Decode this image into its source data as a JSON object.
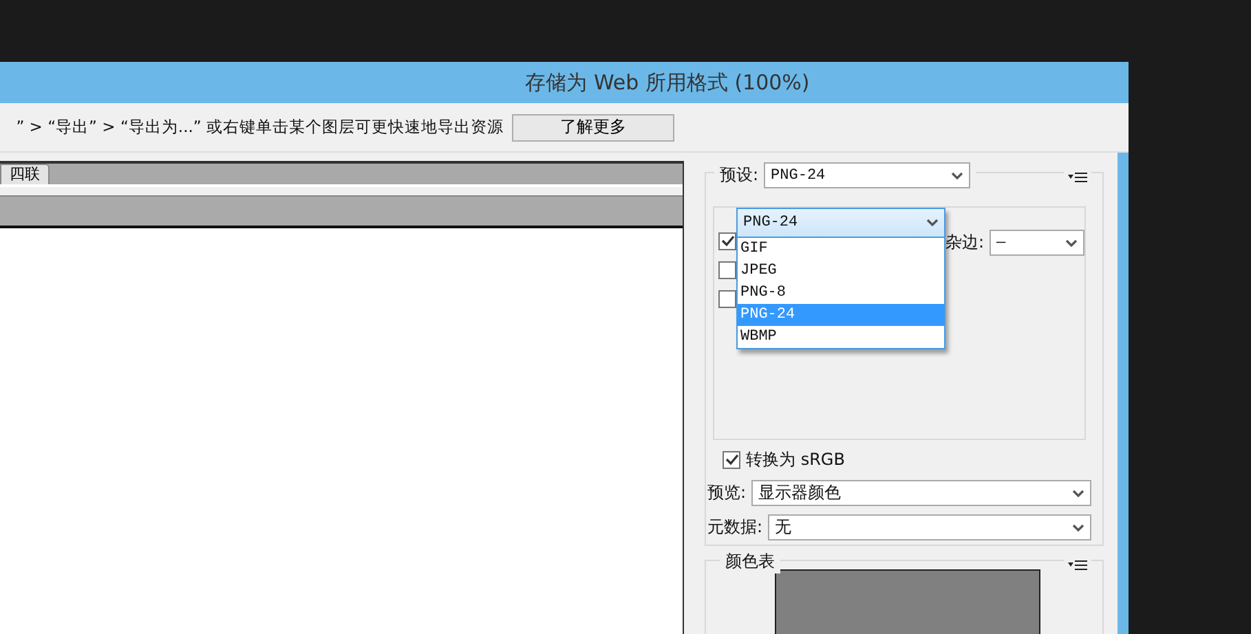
{
  "window": {
    "title": "存储为 Web 所用格式 (100%)"
  },
  "info_bar": {
    "text": "” > “导出” > “导出为...” 或右键单击某个图层可更快速地导出资源",
    "button": "了解更多"
  },
  "view_tabs": [
    {
      "label": "四联",
      "selected": false
    }
  ],
  "settings": {
    "preset_label": "预设:",
    "preset_value": "PNG-24",
    "format": {
      "value": "PNG-24",
      "expanded": true,
      "options": [
        {
          "label": "GIF",
          "selected": false
        },
        {
          "label": "JPEG",
          "selected": false
        },
        {
          "label": "PNG-8",
          "selected": false
        },
        {
          "label": "PNG-24",
          "selected": true
        },
        {
          "label": "WBMP",
          "selected": false
        }
      ]
    },
    "hidden_checkboxes": [
      {
        "checked": true
      },
      {
        "checked": false
      },
      {
        "checked": false
      }
    ],
    "matte_label": "杂边:",
    "matte_value": "—",
    "convert_srgb": {
      "label": "转换为 sRGB",
      "checked": true
    },
    "preview_label": "预览:",
    "preview_value": "显示器颜色",
    "metadata_label": "元数据:",
    "metadata_value": "无",
    "color_table_title": "颜色表"
  }
}
